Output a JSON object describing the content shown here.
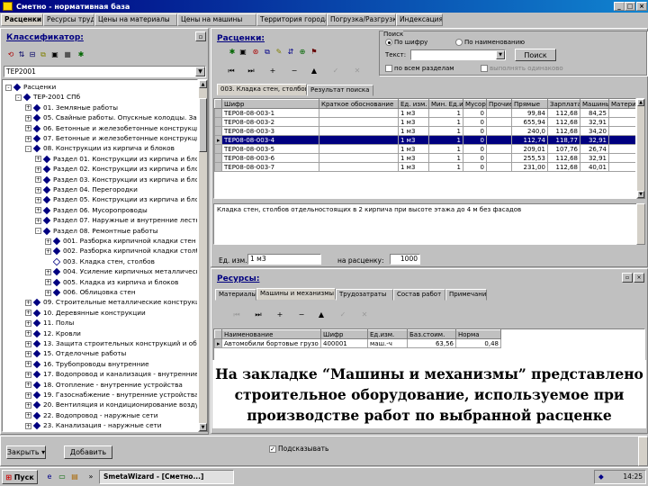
{
  "window": {
    "title": "Сметно - нормативная база",
    "min": "_",
    "max": "□",
    "close": "×"
  },
  "menu_tabs": [
    "Расценки",
    "Ресурсы труда",
    "Цены на материалы",
    "Цены на машины",
    "Территория города",
    "Погрузка/Разгрузка",
    "Индексация"
  ],
  "classifier": {
    "title": "Классификатор:",
    "code": "ТЕР2001",
    "tree": [
      {
        "t": "Расценки",
        "exp": "-",
        "lvl": 0
      },
      {
        "t": "ТЕР-2001 СПб",
        "exp": "-",
        "lvl": 1
      },
      {
        "t": "01. Земляные работы",
        "exp": "+",
        "lvl": 2
      },
      {
        "t": "05. Свайные работы. Опускные колодцы. Зак",
        "exp": "+",
        "lvl": 2
      },
      {
        "t": "06. Бетонные и железобетонные конструкции",
        "exp": "+",
        "lvl": 2
      },
      {
        "t": "07. Бетонные и железобетонные конструкции",
        "exp": "+",
        "lvl": 2
      },
      {
        "t": "08. Конструкции из кирпича и блоков",
        "exp": "-",
        "lvl": 2
      },
      {
        "t": "Раздел 01. Конструкции из кирпича и блоков",
        "exp": "+",
        "lvl": 3
      },
      {
        "t": "Раздел 02. Конструкции из кирпича и блоков",
        "exp": "+",
        "lvl": 3
      },
      {
        "t": "Раздел 03. Конструкции из кирпича и блоков",
        "exp": "+",
        "lvl": 3
      },
      {
        "t": "Раздел 04. Перегородки",
        "exp": "+",
        "lvl": 3
      },
      {
        "t": "Раздел 05. Конструкции из кирпича и блоков",
        "exp": "+",
        "lvl": 3
      },
      {
        "t": "Раздел 06. Мусоропроводы",
        "exp": "+",
        "lvl": 3
      },
      {
        "t": "Раздел 07. Наружные и внутренние лестн",
        "exp": "+",
        "lvl": 3
      },
      {
        "t": "Раздел 08. Ремонтные работы",
        "exp": "-",
        "lvl": 3
      },
      {
        "t": "001. Разборка кирпичной кладки стен",
        "exp": "+",
        "lvl": 4
      },
      {
        "t": "002. Разборка кирпичной кладки столбов",
        "exp": "+",
        "lvl": 4
      },
      {
        "t": "003. Кладка стен, столбов",
        "exp": "",
        "lvl": 4,
        "open": true
      },
      {
        "t": "004. Усиление кирпичных металлических",
        "exp": "+",
        "lvl": 4
      },
      {
        "t": "005. Кладка из кирпича и блоков",
        "exp": "+",
        "lvl": 4
      },
      {
        "t": "006. Облицовка стен",
        "exp": "+",
        "lvl": 4
      },
      {
        "t": "09. Строительные металлические конструкции",
        "exp": "+",
        "lvl": 2
      },
      {
        "t": "10. Деревянные конструкции",
        "exp": "+",
        "lvl": 2
      },
      {
        "t": "11. Полы",
        "exp": "+",
        "lvl": 2
      },
      {
        "t": "12. Кровли",
        "exp": "+",
        "lvl": 2
      },
      {
        "t": "13. Защита строительных конструкций и обо",
        "exp": "+",
        "lvl": 2
      },
      {
        "t": "15. Отделочные работы",
        "exp": "+",
        "lvl": 2
      },
      {
        "t": "16. Трубопроводы внутренние",
        "exp": "+",
        "lvl": 2
      },
      {
        "t": "17. Водопровод и канализация - внутренние",
        "exp": "+",
        "lvl": 2
      },
      {
        "t": "18. Отопление - внутренние устройства",
        "exp": "+",
        "lvl": 2
      },
      {
        "t": "19. Газоснабжение - внутренние устройства",
        "exp": "+",
        "lvl": 2
      },
      {
        "t": "20. Вентиляция и кондиционирование воздух",
        "exp": "+",
        "lvl": 2
      },
      {
        "t": "22. Водопровод - наружные сети",
        "exp": "+",
        "lvl": 2
      },
      {
        "t": "23. Канализация - наружные сети",
        "exp": "+",
        "lvl": 2
      }
    ]
  },
  "rates": {
    "title": "Расценки:",
    "search": {
      "group": "Поиск",
      "by_code": "По шифру",
      "by_name": "По наименованию",
      "text_label": "Текст:",
      "find_btn": "Поиск",
      "all_sections": "по всем разделам",
      "extra": "выполнять одинаково"
    },
    "tabs": [
      "003. Кладка стен, столбов",
      "Результат поиска"
    ],
    "columns": [
      "Шифр",
      "Краткое обоснование",
      "Ед. изм.",
      "Мин. Ед.изм.",
      "Мусор",
      "Прочие",
      "Прямые",
      "Зарплата",
      "Машины",
      "Материалы"
    ],
    "rows": [
      [
        "ТЕР08-08-003-1",
        "",
        "1 м3",
        "1",
        "0",
        "",
        "99,84",
        "112,68",
        "84,25",
        ""
      ],
      [
        "ТЕР08-08-003-2",
        "",
        "1 м3",
        "1",
        "0",
        "",
        "655,94",
        "112,68",
        "32,91",
        ""
      ],
      [
        "ТЕР08-08-003-3",
        "",
        "1 м3",
        "1",
        "0",
        "",
        "240,0",
        "112,68",
        "34,20",
        ""
      ],
      [
        "ТЕР08-08-003-4",
        "",
        "1 м3",
        "1",
        "0",
        "",
        "112,74",
        "118,77",
        "32,91",
        ""
      ],
      [
        "ТЕР08-08-003-5",
        "",
        "1 м3",
        "1",
        "0",
        "",
        "209,01",
        "107,76",
        "26,74",
        ""
      ],
      [
        "ТЕР08-08-003-6",
        "",
        "1 м3",
        "1",
        "0",
        "",
        "255,53",
        "112,68",
        "32,91",
        ""
      ],
      [
        "ТЕР08-08-003-7",
        "",
        "1 м3",
        "1",
        "0",
        "",
        "231,00",
        "112,68",
        "40,01",
        ""
      ]
    ],
    "selected_row": 3,
    "description": "Кладка стен, столбов отдельностоящих в 2 кирпича при высоте этажа до 4 м без фасадов",
    "unit_label": "Ед. изм.:",
    "unit_value": "1 м3",
    "per_label": "на расценку:",
    "per_value": "1000"
  },
  "resources": {
    "title": "Ресурсы:",
    "tabs": [
      "Материалы",
      "Машины и механизмы",
      "Трудозатраты",
      "Состав работ",
      "Примечания"
    ],
    "columns": [
      "Наименование",
      "Шифр",
      "Ед.изм.",
      "Баз.стоим.",
      "Норма"
    ],
    "rows": [
      [
        "Автомобили бортовые грузо",
        "400001",
        "маш.-ч",
        "63,56",
        "0,48"
      ]
    ]
  },
  "caption": {
    "line1": "На закладке “Машины и механизмы” представлено",
    "line2": "строительное оборудование, используемое при",
    "line3": "производстве работ по выбранной расценке"
  },
  "bottom": {
    "close_btn": "Закрыть",
    "add_btn": "Добавить",
    "checkbox": "Подсказывать"
  },
  "taskbar": {
    "start": "Пуск",
    "task": "SmetaWizard - [Сметно...]",
    "clock": "14:25"
  }
}
